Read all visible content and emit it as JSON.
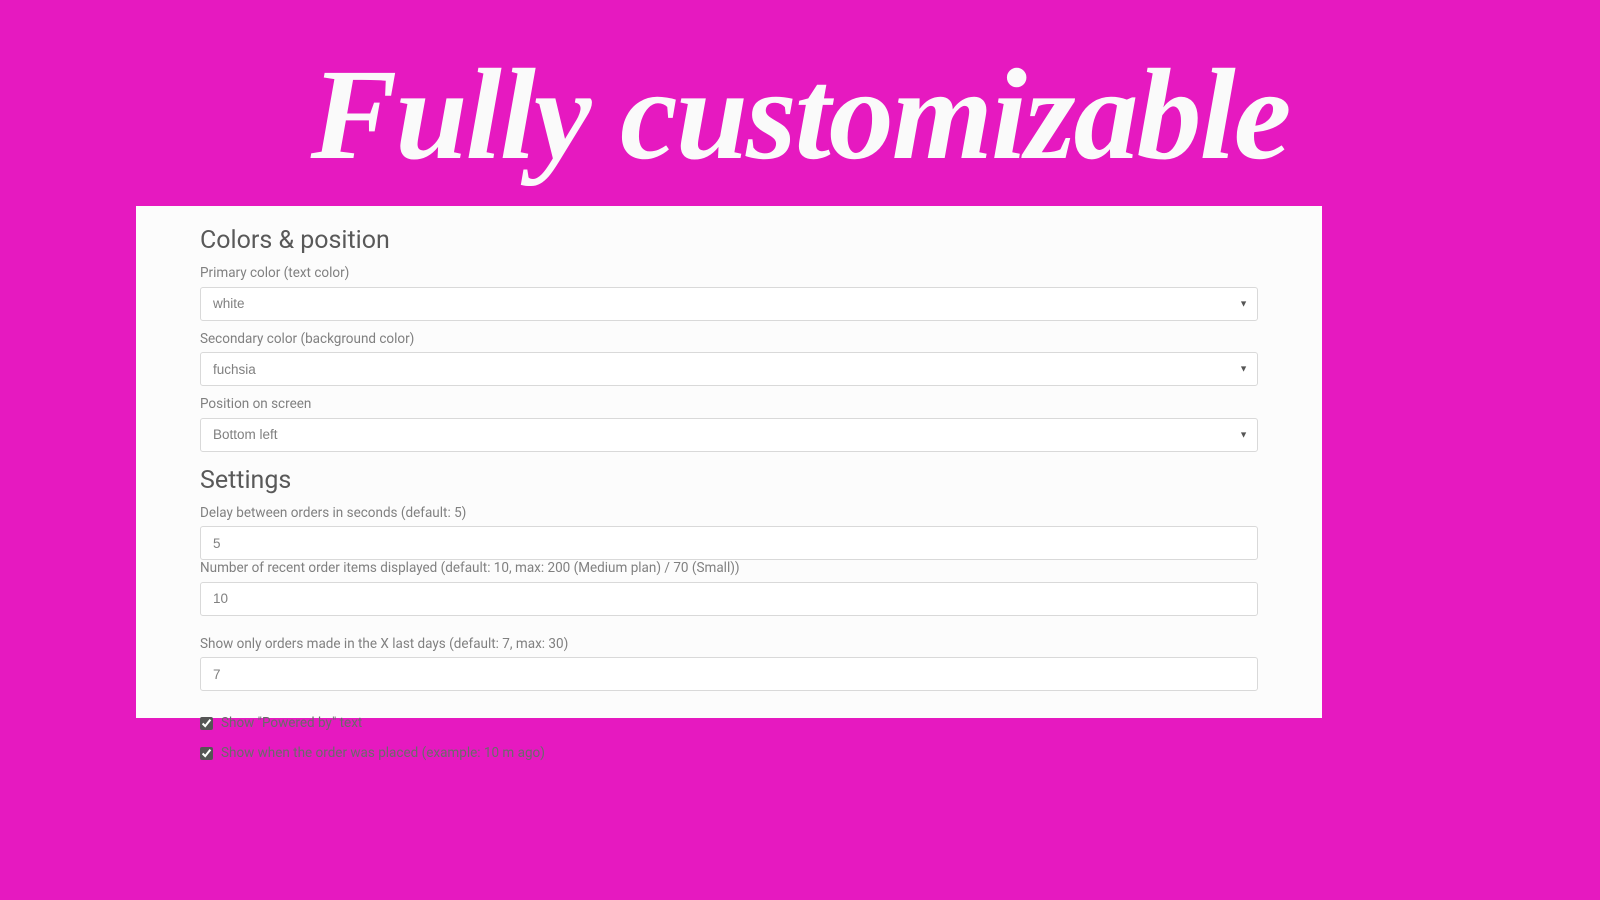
{
  "hero": {
    "title": "Fully customizable"
  },
  "sections": {
    "colors": {
      "heading": "Colors & position",
      "primary_label": "Primary color (text color)",
      "primary_value": "white",
      "secondary_label": "Secondary color (background color)",
      "secondary_value": "fuchsia",
      "position_label": "Position on screen",
      "position_value": "Bottom left"
    },
    "settings": {
      "heading": "Settings",
      "delay_label": "Delay between orders in seconds (default: 5)",
      "delay_value": "5",
      "count_label": "Number of recent order items displayed (default: 10, max: 200 (Medium plan) / 70 (Small))",
      "count_value": "10",
      "days_label": "Show only orders made in the X last days (default: 7, max: 30)",
      "days_value": "7",
      "powered_by_label": "Show \"Powered by\" text",
      "powered_by_checked": true,
      "timestamp_label": "Show when the order was placed (example: 10 m ago)",
      "timestamp_checked": true
    }
  }
}
